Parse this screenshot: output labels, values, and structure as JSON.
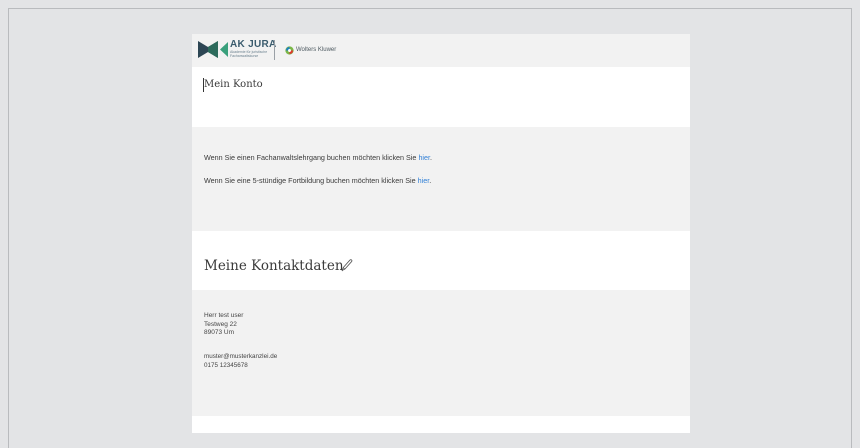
{
  "header": {
    "brand_name": "AK JURA",
    "brand_tagline": "Akademie für juristische Fachanwaltskurse",
    "partner_name": "Wolters Kluwer"
  },
  "account": {
    "title": "Mein Konto"
  },
  "booking": {
    "line1_text": "Wenn Sie einen Fachanwaltslehrgang buchen möchten klicken Sie ",
    "line1_link": "hier",
    "line2_text": "Wenn Sie eine 5-stündige Fortbildung buchen möchten klicken Sie ",
    "line2_link": "hier"
  },
  "contact": {
    "title": "Meine Kontaktdaten",
    "name": "Herr test user",
    "street": "Testweg 22",
    "city": "89073 Um",
    "email": "muster@musterkanzlei.de",
    "phone": "0175 12345678"
  },
  "colors": {
    "link": "#2f7fd6",
    "brand_dark": "#2d4654",
    "brand_green": "#3aa07c"
  }
}
